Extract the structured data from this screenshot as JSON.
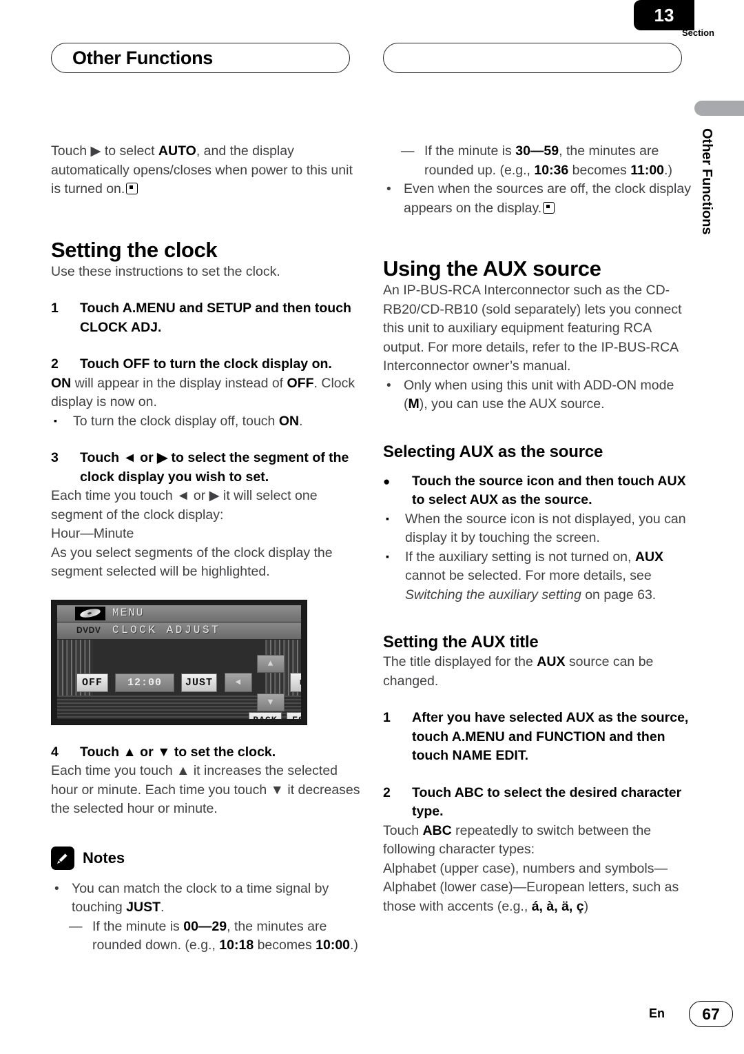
{
  "header": {
    "chapter_title": "Other Functions",
    "section_label": "Section",
    "section_number": "13",
    "side_tab_text": "Other Functions"
  },
  "left_column": {
    "intro_paragraph_pre": "Touch ",
    "intro_arrow": "▶",
    "intro_paragraph_mid": " to select ",
    "intro_bold": "AUTO",
    "intro_paragraph_post": ", and the display automatically opens/closes when power to this unit is turned on.",
    "clock_heading": "Setting the clock",
    "clock_intro": "Use these instructions to set the clock.",
    "step1_num": "1",
    "step1_text": "Touch A.MENU and SETUP and then touch CLOCK ADJ.",
    "step2_num": "2",
    "step2_text": "Touch OFF to turn the clock display on.",
    "step2_body_on": "ON",
    "step2_body_mid": " will appear in the display instead of ",
    "step2_body_off": "OFF",
    "step2_body_end": ". Clock display is now on.",
    "step2_note_marker": "▪",
    "step2_note_pre": "To turn the clock display off, touch ",
    "step2_note_bold": "ON",
    "step2_note_post": ".",
    "step3_num": "3",
    "step3_text": "Touch ◄ or ▶ to select the segment of the clock display you wish to set.",
    "step3_body_1": "Each time you touch ◄ or ▶ it will select one segment of the clock display:",
    "step3_body_2": "Hour—Minute",
    "step3_body_3": "As you select segments of the clock display the segment selected will be highlighted.",
    "step4_num": "4",
    "step4_text": "Touch ▲ or ▼ to set the clock.",
    "step4_body": "Each time you touch ▲ it increases the selected hour or minute. Each time you touch ▼ it decreases the selected hour or minute.",
    "notes_title": "Notes",
    "notes_icon": "pencil-icon",
    "note1_marker": "•",
    "note1_pre": "You can match the clock to a time signal by touching ",
    "note1_bold": "JUST",
    "note1_post": ".",
    "note1_sub_marker": "—",
    "note1_sub_pre": "If the minute is ",
    "note1_sub_b1": "00—29",
    "note1_sub_mid": ", the minutes are rounded down. (e.g., ",
    "note1_sub_b2": "10:18",
    "note1_sub_mid2": " becomes ",
    "note1_sub_b3": "10:00",
    "note1_sub_post": ".)"
  },
  "device_screenshot": {
    "menu_label": "MENU",
    "disc_icon": "disc-icon",
    "dvd_logo": "DVDV",
    "screen_title": "CLOCK ADJUST",
    "off_button": "OFF",
    "time_value": "12:00",
    "just_button": "JUST",
    "left_arrow": "◄",
    "up_arrow": "▲",
    "down_arrow": "▼",
    "right_arrow": "▶",
    "back_button": "BACK",
    "esc_button": "ESC"
  },
  "right_column": {
    "cont_sub_marker": "—",
    "cont_sub_pre": "If the minute is ",
    "cont_sub_b1": "30—59",
    "cont_sub_mid": ", the minutes are rounded up. (e.g., ",
    "cont_sub_b2": "10:36",
    "cont_sub_mid2": " becomes ",
    "cont_sub_b3": "11:00",
    "cont_sub_post": ".)",
    "cont_bullet_marker": "•",
    "cont_bullet_text": "Even when the sources are off, the clock display appears on the display.",
    "aux_heading": "Using the AUX source",
    "aux_body": "An IP-BUS-RCA Interconnector such as the CD-RB20/CD-RB10 (sold separately) lets you connect this unit to auxiliary equipment featuring RCA output. For more details, refer to the IP-BUS-RCA Interconnector owner’s manual.",
    "aux_bullet_marker": "•",
    "aux_bullet_pre": "Only when using this unit with ADD-ON mode (",
    "aux_bullet_bold": "M",
    "aux_bullet_post": "), you can use the AUX source.",
    "selecting_heading": "Selecting AUX as the source",
    "selecting_step_marker": "●",
    "selecting_step_text": "Touch the source icon and then touch AUX to select AUX as the source.",
    "selecting_note1_marker": "▪",
    "selecting_note1_text": "When the source icon is not displayed, you can display it by touching the screen.",
    "selecting_note2_marker": "▪",
    "selecting_note2_pre": "If the auxiliary setting is not turned on, ",
    "selecting_note2_bold": "AUX",
    "selecting_note2_mid": " cannot be selected. For more details, see ",
    "selecting_note2_italic": "Switching the auxiliary setting",
    "selecting_note2_post": " on page 63.",
    "title_heading": "Setting the AUX title",
    "title_body_pre": "The title displayed for the ",
    "title_body_bold": "AUX",
    "title_body_post": " source can be changed.",
    "title_step1_num": "1",
    "title_step1_text": "After you have selected AUX as the source, touch A.MENU and FUNCTION and then touch NAME EDIT.",
    "title_step2_num": "2",
    "title_step2_text": "Touch ABC to select the desired character type.",
    "title_step2_body_pre": "Touch ",
    "title_step2_body_bold": "ABC",
    "title_step2_body_post": " repeatedly to switch between the following character types:",
    "title_step2_body_2": "Alphabet (upper case), numbers and symbols—Alphabet (lower case)—European letters, such as those with accents (e.g., ",
    "title_step2_body_accents": "á, à, ä, ç",
    "title_step2_body_end": ")"
  },
  "footer": {
    "language": "En",
    "page_number": "67"
  }
}
